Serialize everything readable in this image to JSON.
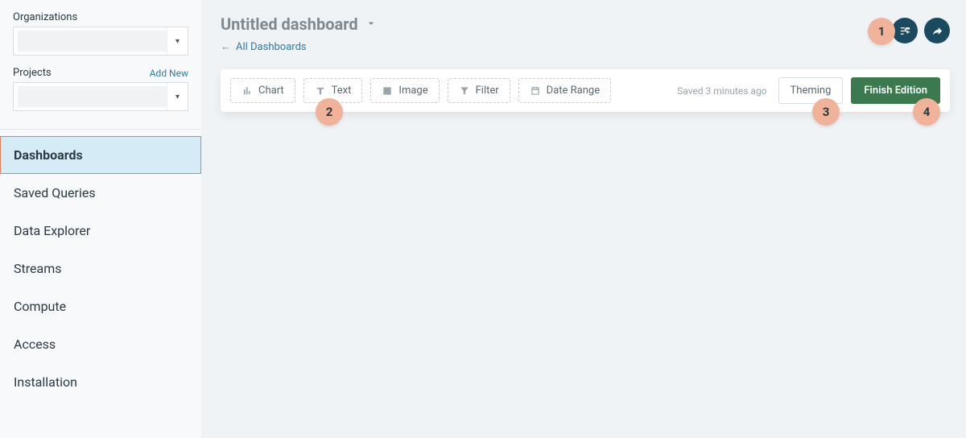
{
  "sidebar": {
    "org_label": "Organizations",
    "projects_label": "Projects",
    "add_new": "Add New",
    "nav": [
      {
        "label": "Dashboards",
        "active": true
      },
      {
        "label": "Saved Queries",
        "active": false
      },
      {
        "label": "Data Explorer",
        "active": false
      },
      {
        "label": "Streams",
        "active": false
      },
      {
        "label": "Compute",
        "active": false
      },
      {
        "label": "Access",
        "active": false
      },
      {
        "label": "Installation",
        "active": false
      }
    ]
  },
  "header": {
    "title": "Untitled dashboard",
    "breadcrumb": "All Dashboards"
  },
  "toolbar": {
    "chart": "Chart",
    "text": "Text",
    "image": "Image",
    "filter": "Filter",
    "date_range": "Date Range",
    "saved": "Saved 3 minutes ago",
    "theming": "Theming",
    "finish": "Finish Edition"
  },
  "callouts": {
    "c1": "1",
    "c2": "2",
    "c3": "3",
    "c4": "4"
  }
}
